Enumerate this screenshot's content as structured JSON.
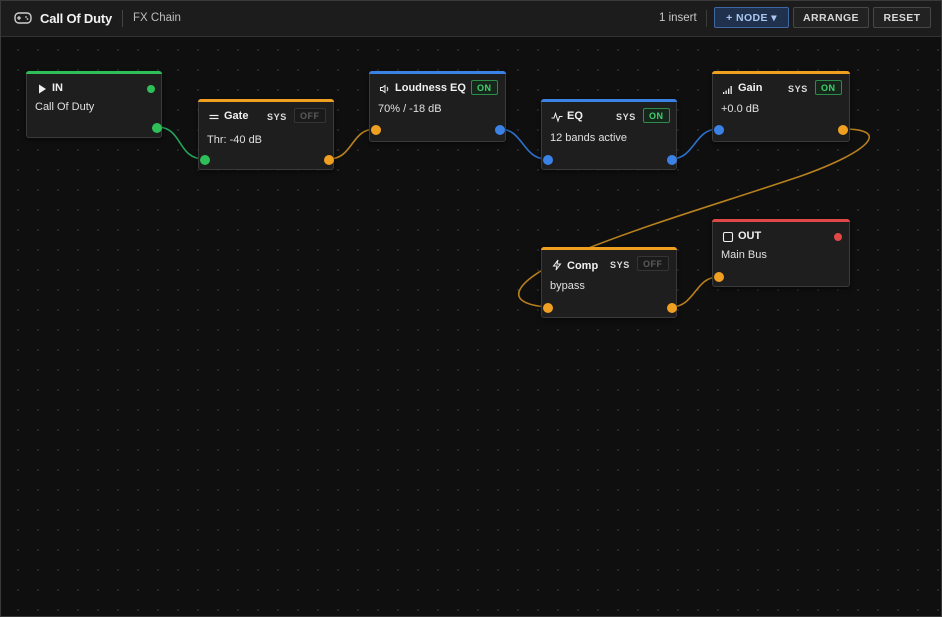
{
  "header": {
    "title": "Call Of Duty",
    "subtitle": "FX Chain",
    "insert_count": "1 insert",
    "buttons": {
      "node": "+ NODE ▾",
      "arrange": "ARRANGE",
      "reset": "RESET"
    }
  },
  "colors": {
    "green": "#2fbf58",
    "orange": "#f0a020",
    "blue": "#3b82e6",
    "red": "#e04848",
    "wire_orange": "#b8801f",
    "wire_green": "#23a35a",
    "wire_blue": "#2d6fc9"
  },
  "nodes": {
    "in": {
      "title": "IN",
      "sub": "Call Of Duty",
      "icon": "play-icon"
    },
    "gate": {
      "title": "Gate",
      "sub": "Thr: -40 dB",
      "sys": "SYS",
      "toggle": "OFF",
      "icon": "lines-icon"
    },
    "loudness": {
      "title": "Loudness EQ",
      "sub": "70% / -18 dB",
      "toggle": "ON",
      "icon": "speaker-icon"
    },
    "eq": {
      "title": "EQ",
      "sub": "12 bands active",
      "sys": "SYS",
      "toggle": "ON",
      "icon": "pulse-icon"
    },
    "gain": {
      "title": "Gain",
      "sub": "+0.0 dB",
      "sys": "SYS",
      "toggle": "ON",
      "icon": "signal-bars-icon"
    },
    "comp": {
      "title": "Comp",
      "sub": "bypass",
      "sys": "SYS",
      "toggle": "OFF",
      "icon": "bolt-icon"
    },
    "out": {
      "title": "OUT",
      "sub": "Main Bus",
      "icon": "stop-square-icon"
    }
  }
}
